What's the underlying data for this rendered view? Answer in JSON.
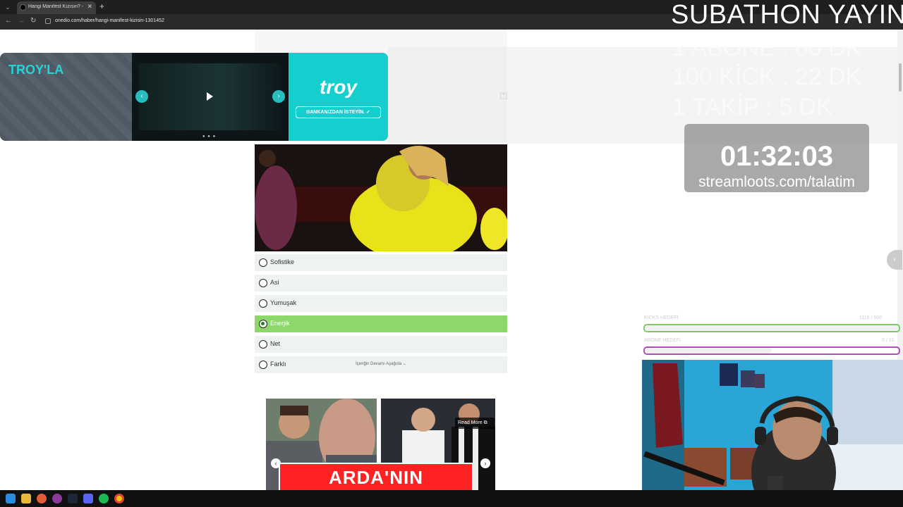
{
  "browser": {
    "tab_title": "Hangi Manifest Kızısın? - O",
    "tab_close": "✕",
    "new_tab": "+",
    "url": "onedio.com/haber/hangi-manifest-kizisin-1301452"
  },
  "ad": {
    "headline": "TROY'LA",
    "brand": "troy",
    "cta": "BANKANIZDAN İSTEYİN. ✓",
    "dots": "● ● ●"
  },
  "quiz": {
    "options": [
      {
        "label": "Sofistike",
        "selected": false
      },
      {
        "label": "Asi",
        "selected": false
      },
      {
        "label": "Yumuşak",
        "selected": false
      },
      {
        "label": "Enerjik",
        "selected": true
      },
      {
        "label": "Net",
        "selected": false
      },
      {
        "label": "Farklı",
        "selected": false
      }
    ],
    "continue_text": "İçeriğin Devamı Aşağıda ⌄"
  },
  "recommendations": {
    "read_more": "Read More ⧉",
    "banner_text": "ARDA'NIN"
  },
  "stream": {
    "title": "SUBATHON YAYIN",
    "rules": [
      "1 ABONE : 60 DK",
      "100 KİCK : 22 DK",
      "1 TAKİP : 5 DK"
    ],
    "timer": "01:32:03",
    "link": "streamloots.com/talatim",
    "goals": [
      {
        "label": "KİCKS HEDEFİ",
        "value": "1116 / 500",
        "progress": 1.0,
        "color": "#7fc96b"
      },
      {
        "label": "ABONE HEDEFİ",
        "value": "5 / 10",
        "progress": 0.5,
        "color": "#b04fb8"
      }
    ]
  }
}
